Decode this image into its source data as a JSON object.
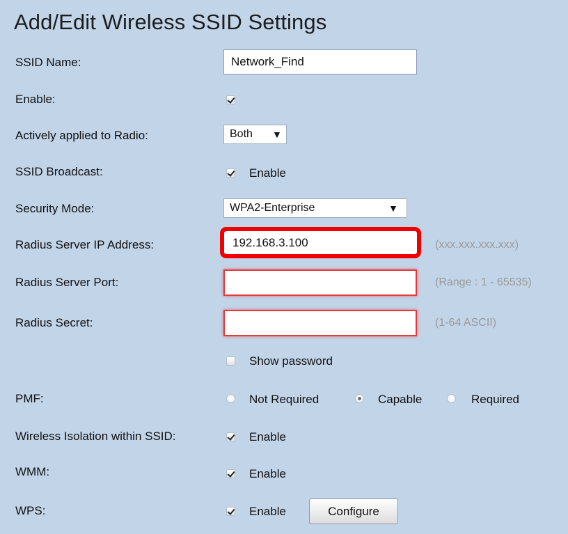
{
  "page": {
    "title": "Add/Edit Wireless SSID Settings"
  },
  "fields": {
    "ssid_name": {
      "label": "SSID Name:",
      "value": "Network_Find"
    },
    "enable": {
      "label": "Enable:",
      "checked": true
    },
    "radio": {
      "label": "Actively applied to Radio:",
      "selected": "Both",
      "arrow": "▼"
    },
    "ssid_broadcast": {
      "label": "SSID Broadcast:",
      "option_label": "Enable",
      "checked": true
    },
    "security_mode": {
      "label": "Security Mode:",
      "selected": "WPA2-Enterprise",
      "arrow": "▼"
    },
    "radius_ip": {
      "label": "Radius Server IP Address:",
      "value": "192.168.3.100",
      "hint": "(xxx.xxx.xxx.xxx)"
    },
    "radius_port": {
      "label": "Radius Server Port:",
      "value": "",
      "hint": "(Range : 1 - 65535)"
    },
    "radius_secret": {
      "label": "Radius Secret:",
      "value": "",
      "hint": "(1-64 ASCII)"
    },
    "show_password": {
      "label": "Show password",
      "checked": false
    },
    "pmf": {
      "label": "PMF:",
      "options": [
        "Not Required",
        "Capable",
        "Required"
      ],
      "selected": "Capable"
    },
    "wireless_isolation": {
      "label": "Wireless Isolation within SSID:",
      "option_label": "Enable",
      "checked": true
    },
    "wmm": {
      "label": "WMM:",
      "option_label": "Enable",
      "checked": true
    },
    "wps": {
      "label": "WPS:",
      "option_label": "Enable",
      "checked": true,
      "button_label": "Configure"
    }
  },
  "colors": {
    "background": "#c2d4e8",
    "highlight_red": "#f10000",
    "error_red": "#e33b3b",
    "hint_gray": "#9a9a9a"
  },
  "icons": {
    "checkmark": "checkmark-icon",
    "dropdown": "chevron-down-icon"
  }
}
